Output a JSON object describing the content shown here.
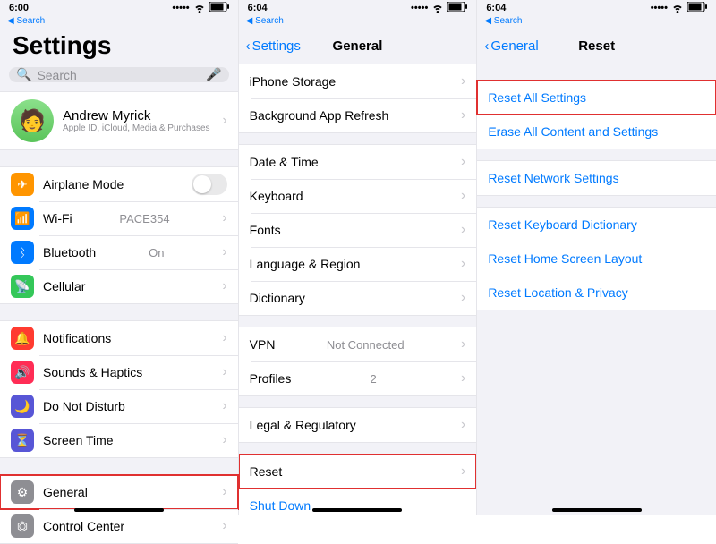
{
  "s1": {
    "time": "6:00",
    "backline": "Search",
    "title": "Settings",
    "searchPlaceholder": "Search",
    "profile": {
      "name": "Andrew Myrick",
      "sub": "Apple ID, iCloud, Media & Purchases"
    },
    "rows": {
      "airplane": "Airplane Mode",
      "wifi": "Wi-Fi",
      "wifiVal": "PACE354",
      "bt": "Bluetooth",
      "btVal": "On",
      "cell": "Cellular",
      "notif": "Notifications",
      "sounds": "Sounds & Haptics",
      "dnd": "Do Not Disturb",
      "screentime": "Screen Time",
      "general": "General",
      "control": "Control Center"
    }
  },
  "s2": {
    "time": "6:04",
    "backline": "Search",
    "back": "Settings",
    "title": "General",
    "rows": {
      "storage": "iPhone Storage",
      "bgrefresh": "Background App Refresh",
      "datetime": "Date & Time",
      "keyboard": "Keyboard",
      "fonts": "Fonts",
      "lang": "Language & Region",
      "dict": "Dictionary",
      "vpn": "VPN",
      "vpnVal": "Not Connected",
      "profiles": "Profiles",
      "profilesVal": "2",
      "legal": "Legal & Regulatory",
      "reset": "Reset",
      "shutdown": "Shut Down"
    }
  },
  "s3": {
    "time": "6:04",
    "backline": "Search",
    "back": "General",
    "title": "Reset",
    "rows": {
      "resetAll": "Reset All Settings",
      "erase": "Erase All Content and Settings",
      "network": "Reset Network Settings",
      "kbd": "Reset Keyboard Dictionary",
      "home": "Reset Home Screen Layout",
      "loc": "Reset Location & Privacy"
    }
  }
}
